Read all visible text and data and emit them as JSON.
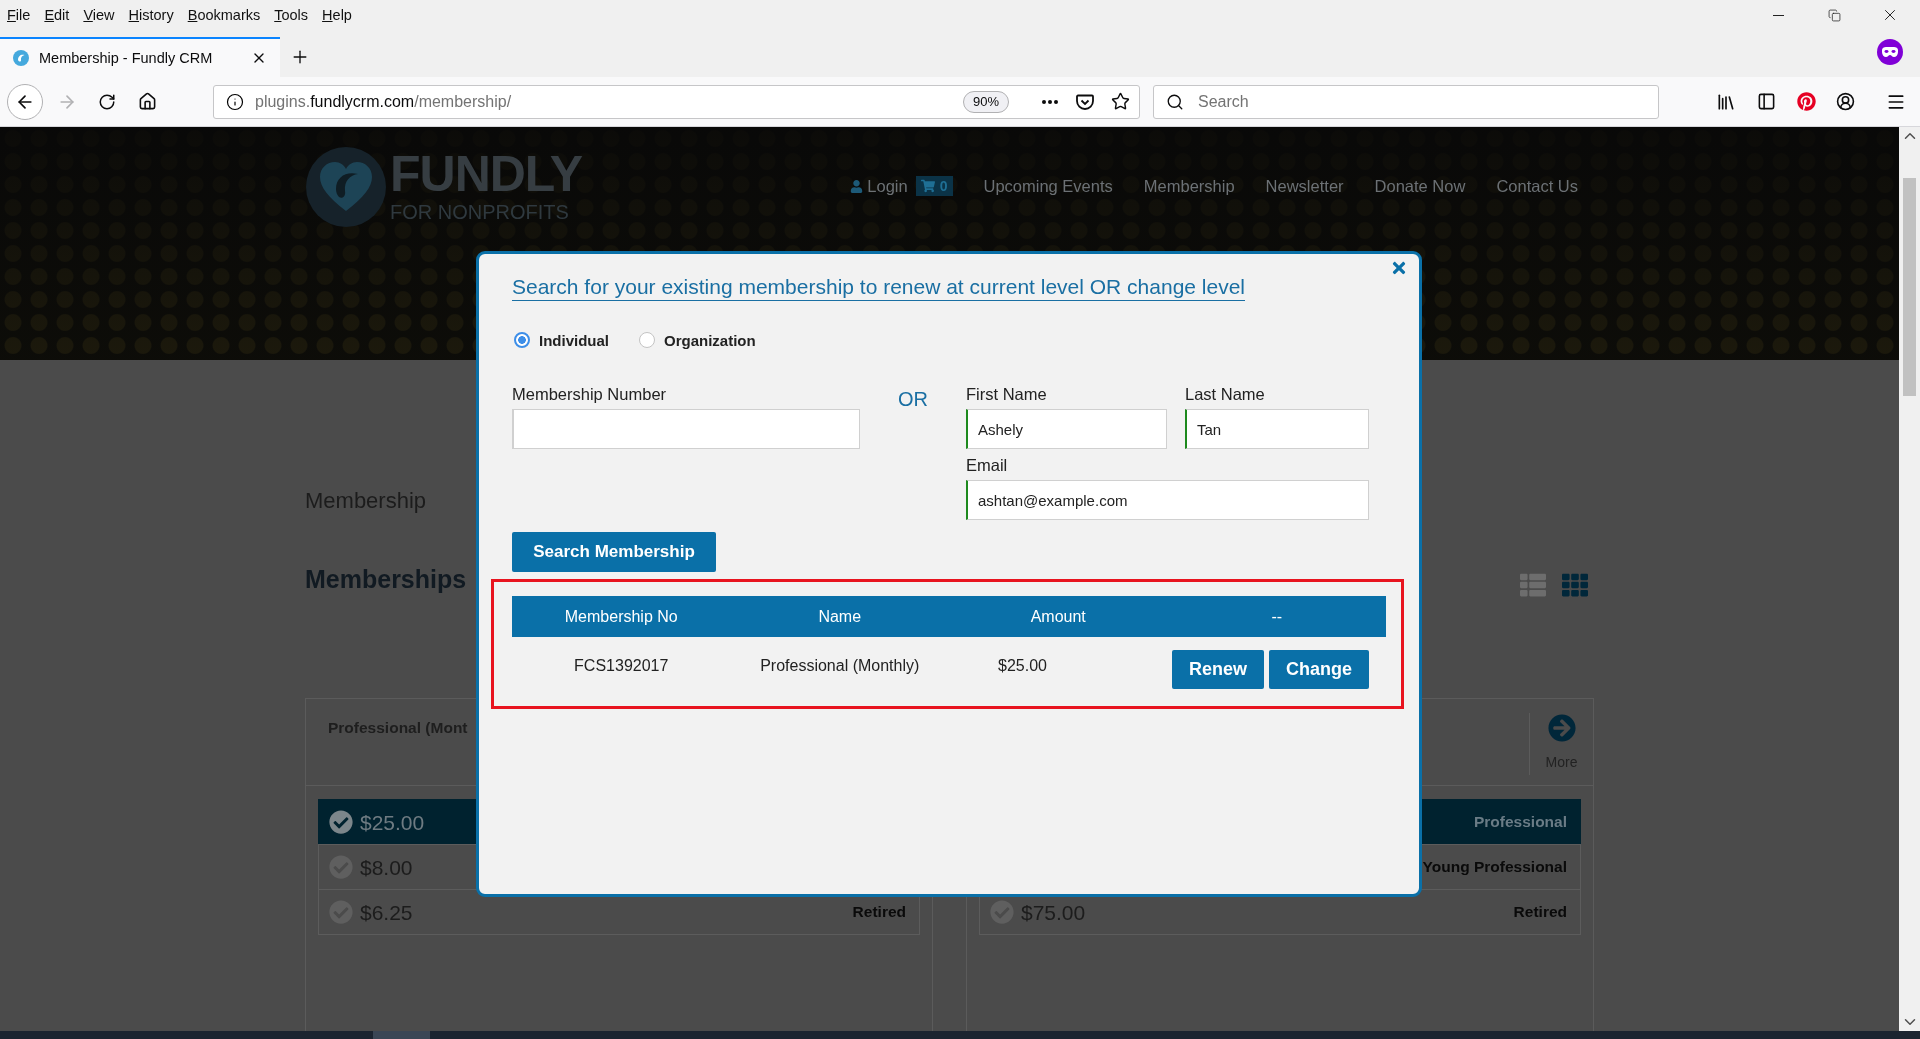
{
  "browser": {
    "menu": [
      "File",
      "Edit",
      "View",
      "History",
      "Bookmarks",
      "Tools",
      "Help"
    ],
    "tabs": [
      {
        "title": "Membership - Fundly CRM",
        "selected": true
      }
    ],
    "nav_buttons": [
      {
        "kind": "back",
        "disabled": false
      },
      {
        "kind": "forward",
        "disabled": true
      },
      {
        "kind": "reload",
        "disabled": false
      },
      {
        "kind": "home",
        "disabled": false
      }
    ],
    "url": "plugins.fundlycrm.com/membership/",
    "zoom": "90%",
    "search": {
      "placeholder": "Search"
    }
  },
  "site": {
    "logo": {
      "name": "FUNDLY",
      "tagline": "FOR NONPROFITS"
    },
    "nav": [
      {
        "kind": "login",
        "label": "Login"
      },
      {
        "kind": "cart",
        "label": "0"
      },
      {
        "kind": "link",
        "label": "Upcoming Events"
      },
      {
        "kind": "link",
        "label": "Membership"
      },
      {
        "kind": "link",
        "label": "Newsletter"
      },
      {
        "kind": "link",
        "label": "Donate Now"
      },
      {
        "kind": "link",
        "label": "Contact Us"
      }
    ]
  },
  "page": {
    "title": "Membership",
    "heading": "Memberships",
    "view_toggle": [
      {
        "kind": "list",
        "selected": false
      },
      {
        "kind": "grid",
        "selected": true
      }
    ],
    "cards": [
      {
        "title": "Professional (Mont",
        "options": [
          {
            "amount": "$25.00",
            "selected": true
          },
          {
            "amount": "$8.00",
            "selected": false
          },
          {
            "amount": "$6.25",
            "label": "Retired",
            "selected": false
          }
        ]
      },
      {
        "more": "More",
        "options": [
          {
            "label": "Professional",
            "selected": true
          },
          {
            "label": "Young Professional",
            "selected": false
          },
          {
            "amount": "$75.00",
            "label": "Retired",
            "selected": false
          }
        ]
      }
    ]
  },
  "modal": {
    "title": "Search for your existing membership to renew at current level OR change level",
    "types": [
      {
        "label": "Individual",
        "selected": true
      },
      {
        "label": "Organization",
        "selected": false
      }
    ],
    "membership_number": {
      "label": "Membership Number",
      "valid": false
    },
    "separator": "OR",
    "first_name": {
      "label": "First Name",
      "value": "Ashely",
      "valid": true
    },
    "last_name": {
      "label": "Last Name",
      "value": "Tan",
      "valid": true
    },
    "email": {
      "label": "Email",
      "value": "ashtan@example.com",
      "valid": true
    },
    "search_button": "Search Membership",
    "results": {
      "highlighted": true,
      "columns": [
        "Membership No",
        "Name",
        "Amount",
        "--"
      ],
      "rows": [
        {
          "number": "FCS1392017",
          "name": "Professional (Monthly)",
          "amount": "$25.00",
          "actions": [
            "Renew",
            "Change"
          ]
        }
      ]
    }
  }
}
